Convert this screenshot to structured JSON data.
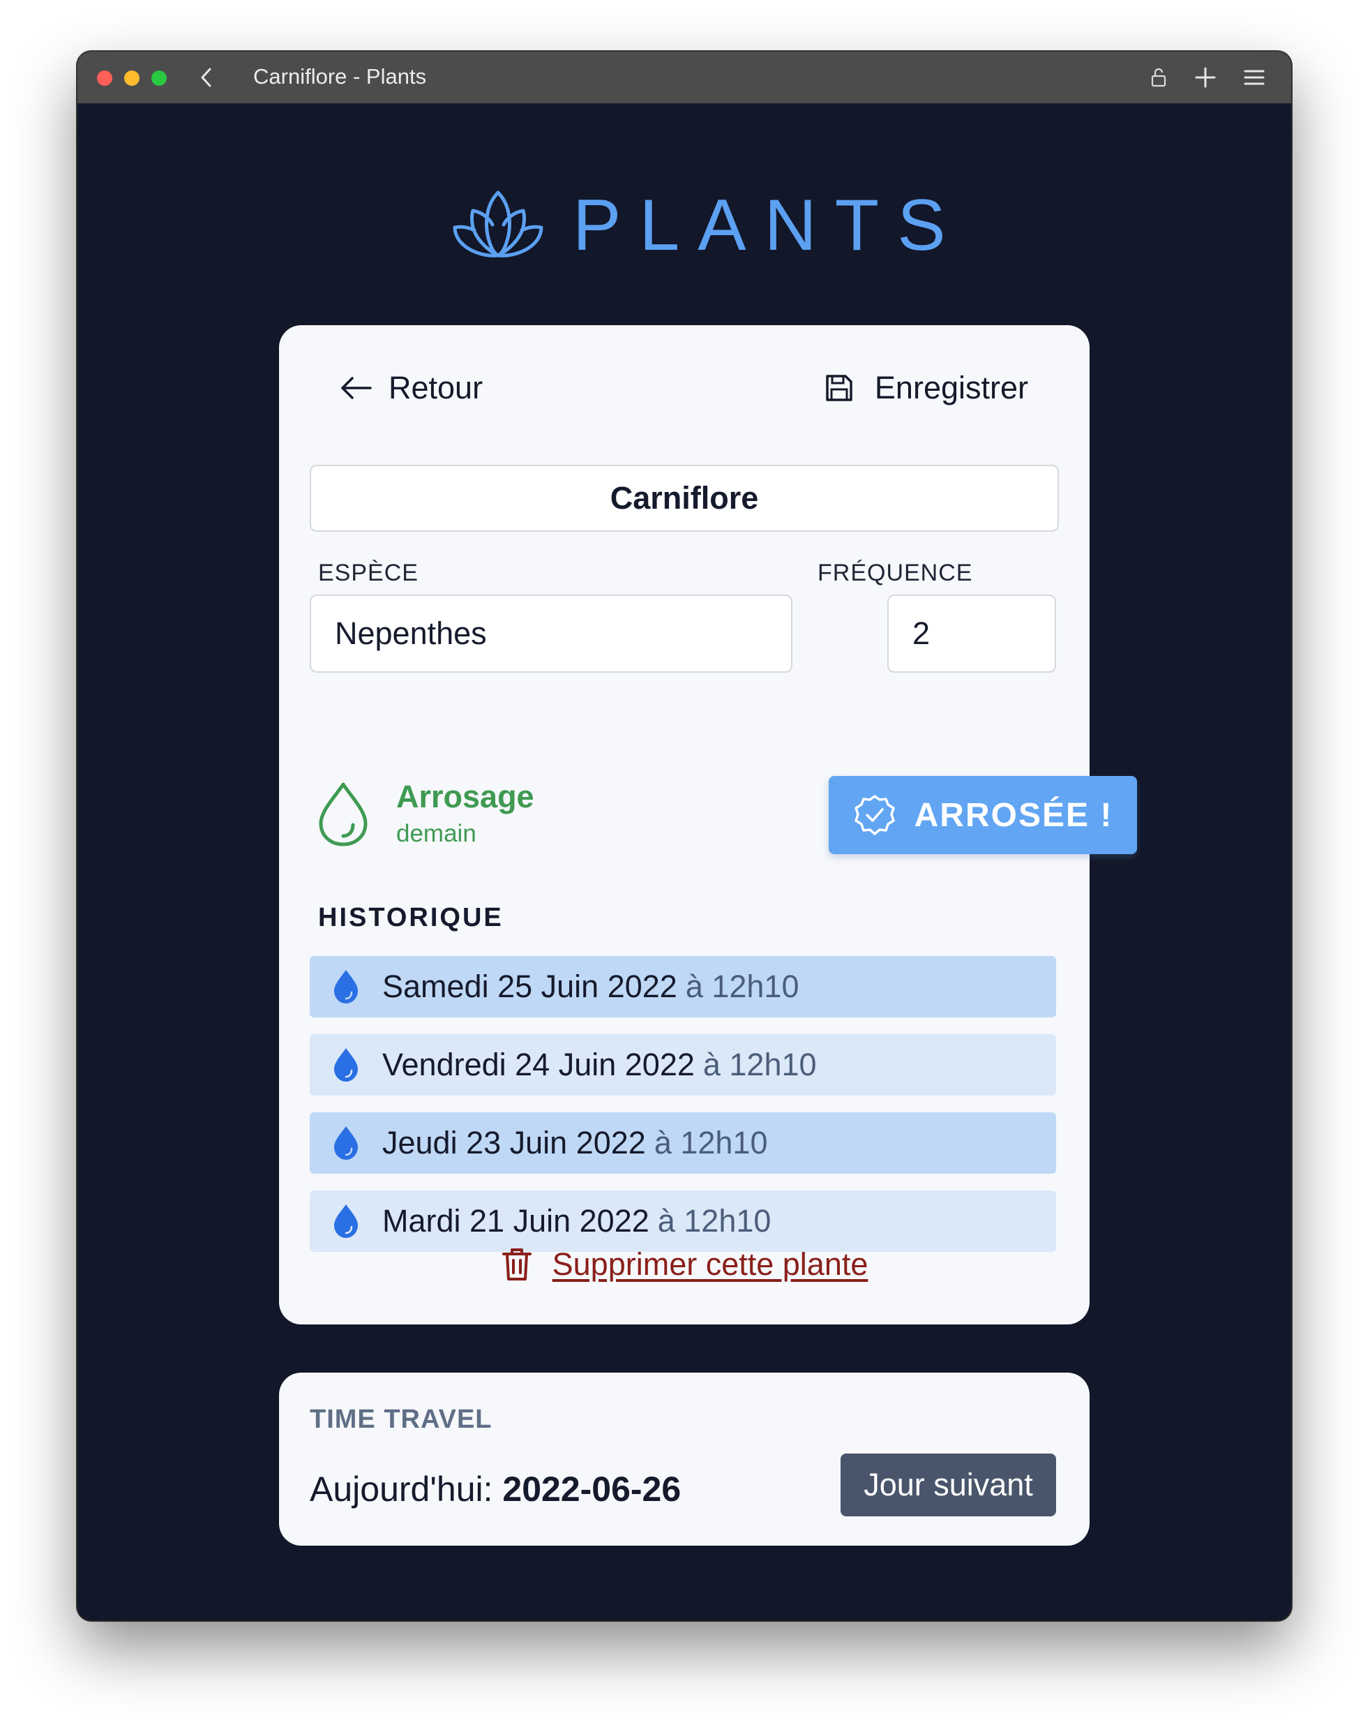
{
  "browser": {
    "title": "Carniflore - Plants",
    "icons": [
      "back-chevron-icon",
      "lock-icon",
      "plus-icon",
      "menu-icon"
    ]
  },
  "brand": {
    "title": "PLANTS",
    "logo_icon": "lotus-icon",
    "color": "#5ca0f2"
  },
  "plant": {
    "back_label": "Retour",
    "save_label": "Enregistrer",
    "name": "Carniflore",
    "species_label": "ESPÈCE",
    "species_value": "Nepenthes",
    "frequency_label": "FRÉQUENCE",
    "frequency_value": "2",
    "watering_title": "Arrosage",
    "watering_when": "demain",
    "watered_button": "ARROSÉE !",
    "history_title": "HISTORIQUE",
    "history": [
      {
        "date": "Samedi 25 Juin 2022",
        "time": "à 12h10"
      },
      {
        "date": "Vendredi 24 Juin 2022",
        "time": "à 12h10"
      },
      {
        "date": "Jeudi 23 Juin 2022",
        "time": "à 12h10"
      },
      {
        "date": "Mardi 21 Juin 2022",
        "time": "à 12h10"
      }
    ],
    "delete_label": "Supprimer cette plante"
  },
  "time_travel": {
    "title": "TIME TRAVEL",
    "today_label": "Aujourd'hui:",
    "today_value": "2022-06-26",
    "next_button": "Jour suivant"
  },
  "colors": {
    "background": "#121729",
    "accent": "#61a5f3",
    "watering_green": "#3f9a52",
    "danger": "#8a1f1a"
  }
}
